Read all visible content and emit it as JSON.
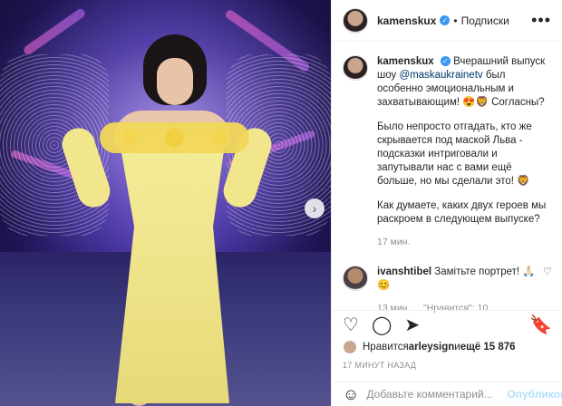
{
  "post": {
    "author": "kamenskux",
    "follow_label": "Подписки",
    "verified_glyph": "✓",
    "dot": "•",
    "more_glyph": "•••",
    "caption_p1": "Вчерашний выпуск шоу ",
    "caption_mention": "@maskaukrainetv",
    "caption_p1_end": " был особенно эмоциональным и захватывающим! 😍🦁 Согласны?",
    "caption_p2": "Было непросто отгадать, кто же скрывается под маской Льва - подсказки интриговали и запутывали нас с вами ещё больше, но мы сделали это! 🦁",
    "caption_p3": "Как думаете, каких двух героев мы раскроем в следующем выпуске?",
    "caption_time": "17 мин."
  },
  "comment": {
    "user": "ivanshtibel",
    "text": " Замітьте портрет! 🙏🏻😊",
    "time": "13 мин.",
    "likes": "\"Нравится\": 10",
    "heart_glyph": "♡"
  },
  "actions": {
    "like_glyph": "♡",
    "comment_glyph": "◯",
    "share_glyph": "➤",
    "save_glyph": "🔖"
  },
  "likes": {
    "prefix": "Нравится ",
    "user": "arleysign",
    "suffix": " и ",
    "count": "ещё 15 876"
  },
  "timestamp": "17 МИНУТ НАЗАД",
  "add_comment": {
    "placeholder": "Добавьте комментарий...",
    "post_label": "Опубликовать",
    "emoji_glyph": "☺"
  },
  "carousel": {
    "next_glyph": "›"
  }
}
